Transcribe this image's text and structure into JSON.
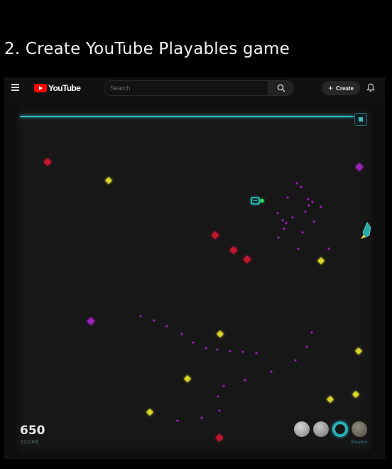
{
  "slide": {
    "title": "2. Create YouTube Playables game"
  },
  "header": {
    "logo_text": "YouTube",
    "search_placeholder": "Search",
    "create_label": "Create"
  },
  "game": {
    "progress": 1.0,
    "score": "650",
    "score_label": "SCORE",
    "powerup_caption": "Slowmo",
    "colors": {
      "background": "#171717",
      "player": "#2ee0e0",
      "player_dot": "#35e05a",
      "enemy_red": "#c1152e",
      "enemy_purple": "#9b20b8",
      "coin": "#d8d42a"
    },
    "icons": [
      "menu-icon",
      "search-icon",
      "plus-icon",
      "bell-icon",
      "pause-icon",
      "rocket-icon"
    ]
  }
}
